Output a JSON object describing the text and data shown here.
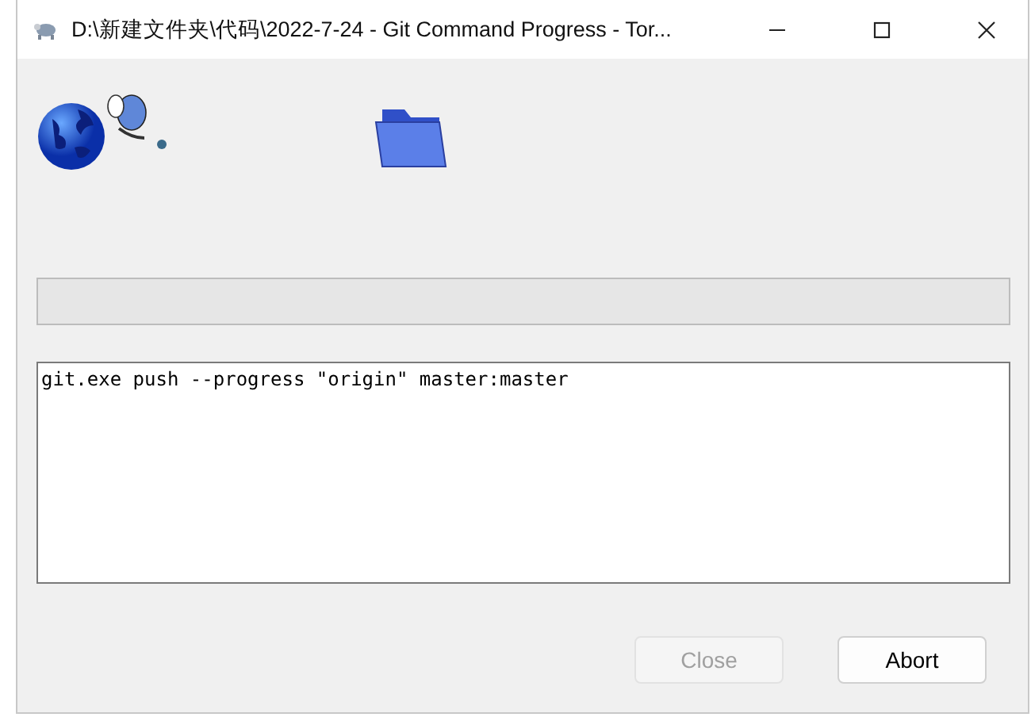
{
  "window": {
    "title": "D:\\新建文件夹\\代码\\2022-7-24 - Git Command Progress - Tor..."
  },
  "progress": {
    "level": 0
  },
  "log": {
    "text": "git.exe push --progress \"origin\" master:master"
  },
  "buttons": [
    {
      "label": "Close",
      "disabled": true
    },
    {
      "label": "Abort",
      "disabled": false
    }
  ]
}
